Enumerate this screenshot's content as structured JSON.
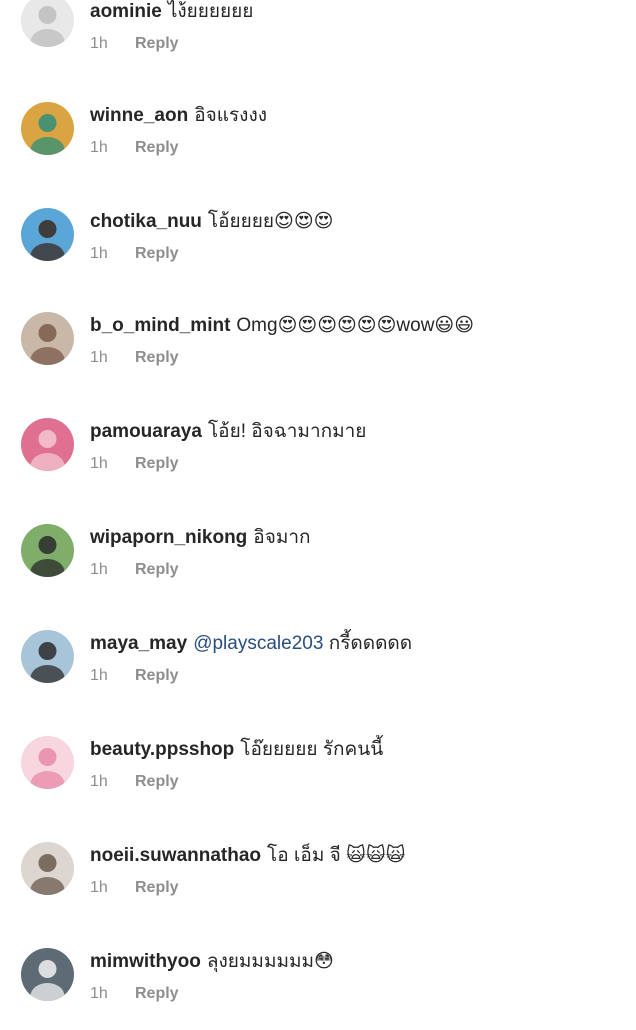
{
  "comments": [
    {
      "username": "aominie",
      "text": "ไง้ยยยยยย",
      "mention": "",
      "time": "1h",
      "reply_label": "Reply",
      "avatar_colors": [
        "#e8e8e8",
        "#bdbdbd"
      ]
    },
    {
      "username": "winne_aon",
      "text": "อิจแรงงง",
      "mention": "",
      "time": "1h",
      "reply_label": "Reply",
      "avatar_colors": [
        "#d9a441",
        "#2f8f7a"
      ]
    },
    {
      "username": "chotika_nuu",
      "text": "โอ้ยยยย😍😍😍",
      "mention": "",
      "time": "1h",
      "reply_label": "Reply",
      "avatar_colors": [
        "#5aa6d6",
        "#3b2a20"
      ]
    },
    {
      "username": "b_o_mind_mint",
      "text": "Omg😍😍😍😍😍😍wow😃😃",
      "mention": "",
      "time": "1h",
      "reply_label": "Reply",
      "avatar_colors": [
        "#c9b8a8",
        "#7a5a48"
      ]
    },
    {
      "username": "pamouaraya",
      "text": "โอ้ย! อิจฉามากมาย",
      "mention": "",
      "time": "1h",
      "reply_label": "Reply",
      "avatar_colors": [
        "#e07090",
        "#f4c6d2"
      ]
    },
    {
      "username": "wipaporn_nikong",
      "text": "อิจมาก",
      "mention": "",
      "time": "1h",
      "reply_label": "Reply",
      "avatar_colors": [
        "#7fae6a",
        "#2a2a2a"
      ]
    },
    {
      "username": "maya_may",
      "text": "กรี้ดดดดด",
      "mention": "@playscale203",
      "time": "1h",
      "reply_label": "Reply",
      "avatar_colors": [
        "#a8c4d8",
        "#2b2b2b"
      ]
    },
    {
      "username": "beauty.ppsshop",
      "text": "โอ๊ยยยยย รักคนนี้",
      "mention": "",
      "time": "1h",
      "reply_label": "Reply",
      "avatar_colors": [
        "#f7d6e0",
        "#e88aa8"
      ]
    },
    {
      "username": "noeii.suwannathao",
      "text": "โอ เอ็ม จี 🙀🙀🙀",
      "mention": "",
      "time": "1h",
      "reply_label": "Reply",
      "avatar_colors": [
        "#ddd5cf",
        "#6b5a4e"
      ]
    },
    {
      "username": "mimwithyoo",
      "text": "ลุงยมมมมมม😳",
      "mention": "",
      "time": "1h",
      "reply_label": "Reply",
      "avatar_colors": [
        "#5d6b75",
        "#f1f1f1"
      ]
    }
  ]
}
